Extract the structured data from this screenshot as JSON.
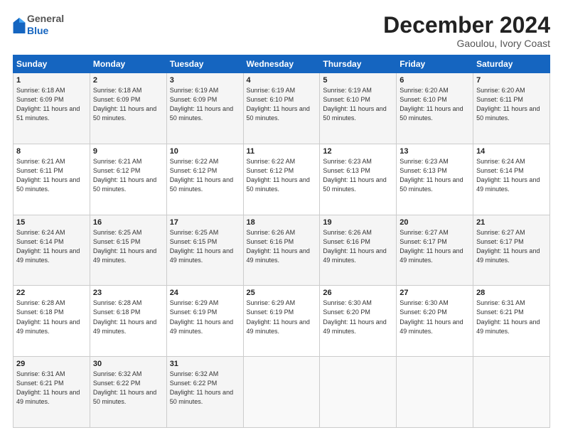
{
  "logo": {
    "general": "General",
    "blue": "Blue"
  },
  "title": "December 2024",
  "location": "Gaoulou, Ivory Coast",
  "days_header": [
    "Sunday",
    "Monday",
    "Tuesday",
    "Wednesday",
    "Thursday",
    "Friday",
    "Saturday"
  ],
  "weeks": [
    [
      {
        "day": "1",
        "sunrise": "6:18 AM",
        "sunset": "6:09 PM",
        "daylight": "11 hours and 51 minutes."
      },
      {
        "day": "2",
        "sunrise": "6:18 AM",
        "sunset": "6:09 PM",
        "daylight": "11 hours and 50 minutes."
      },
      {
        "day": "3",
        "sunrise": "6:19 AM",
        "sunset": "6:09 PM",
        "daylight": "11 hours and 50 minutes."
      },
      {
        "day": "4",
        "sunrise": "6:19 AM",
        "sunset": "6:10 PM",
        "daylight": "11 hours and 50 minutes."
      },
      {
        "day": "5",
        "sunrise": "6:19 AM",
        "sunset": "6:10 PM",
        "daylight": "11 hours and 50 minutes."
      },
      {
        "day": "6",
        "sunrise": "6:20 AM",
        "sunset": "6:10 PM",
        "daylight": "11 hours and 50 minutes."
      },
      {
        "day": "7",
        "sunrise": "6:20 AM",
        "sunset": "6:11 PM",
        "daylight": "11 hours and 50 minutes."
      }
    ],
    [
      {
        "day": "8",
        "sunrise": "6:21 AM",
        "sunset": "6:11 PM",
        "daylight": "11 hours and 50 minutes."
      },
      {
        "day": "9",
        "sunrise": "6:21 AM",
        "sunset": "6:12 PM",
        "daylight": "11 hours and 50 minutes."
      },
      {
        "day": "10",
        "sunrise": "6:22 AM",
        "sunset": "6:12 PM",
        "daylight": "11 hours and 50 minutes."
      },
      {
        "day": "11",
        "sunrise": "6:22 AM",
        "sunset": "6:12 PM",
        "daylight": "11 hours and 50 minutes."
      },
      {
        "day": "12",
        "sunrise": "6:23 AM",
        "sunset": "6:13 PM",
        "daylight": "11 hours and 50 minutes."
      },
      {
        "day": "13",
        "sunrise": "6:23 AM",
        "sunset": "6:13 PM",
        "daylight": "11 hours and 50 minutes."
      },
      {
        "day": "14",
        "sunrise": "6:24 AM",
        "sunset": "6:14 PM",
        "daylight": "11 hours and 49 minutes."
      }
    ],
    [
      {
        "day": "15",
        "sunrise": "6:24 AM",
        "sunset": "6:14 PM",
        "daylight": "11 hours and 49 minutes."
      },
      {
        "day": "16",
        "sunrise": "6:25 AM",
        "sunset": "6:15 PM",
        "daylight": "11 hours and 49 minutes."
      },
      {
        "day": "17",
        "sunrise": "6:25 AM",
        "sunset": "6:15 PM",
        "daylight": "11 hours and 49 minutes."
      },
      {
        "day": "18",
        "sunrise": "6:26 AM",
        "sunset": "6:16 PM",
        "daylight": "11 hours and 49 minutes."
      },
      {
        "day": "19",
        "sunrise": "6:26 AM",
        "sunset": "6:16 PM",
        "daylight": "11 hours and 49 minutes."
      },
      {
        "day": "20",
        "sunrise": "6:27 AM",
        "sunset": "6:17 PM",
        "daylight": "11 hours and 49 minutes."
      },
      {
        "day": "21",
        "sunrise": "6:27 AM",
        "sunset": "6:17 PM",
        "daylight": "11 hours and 49 minutes."
      }
    ],
    [
      {
        "day": "22",
        "sunrise": "6:28 AM",
        "sunset": "6:18 PM",
        "daylight": "11 hours and 49 minutes."
      },
      {
        "day": "23",
        "sunrise": "6:28 AM",
        "sunset": "6:18 PM",
        "daylight": "11 hours and 49 minutes."
      },
      {
        "day": "24",
        "sunrise": "6:29 AM",
        "sunset": "6:19 PM",
        "daylight": "11 hours and 49 minutes."
      },
      {
        "day": "25",
        "sunrise": "6:29 AM",
        "sunset": "6:19 PM",
        "daylight": "11 hours and 49 minutes."
      },
      {
        "day": "26",
        "sunrise": "6:30 AM",
        "sunset": "6:20 PM",
        "daylight": "11 hours and 49 minutes."
      },
      {
        "day": "27",
        "sunrise": "6:30 AM",
        "sunset": "6:20 PM",
        "daylight": "11 hours and 49 minutes."
      },
      {
        "day": "28",
        "sunrise": "6:31 AM",
        "sunset": "6:21 PM",
        "daylight": "11 hours and 49 minutes."
      }
    ],
    [
      {
        "day": "29",
        "sunrise": "6:31 AM",
        "sunset": "6:21 PM",
        "daylight": "11 hours and 49 minutes."
      },
      {
        "day": "30",
        "sunrise": "6:32 AM",
        "sunset": "6:22 PM",
        "daylight": "11 hours and 50 minutes."
      },
      {
        "day": "31",
        "sunrise": "6:32 AM",
        "sunset": "6:22 PM",
        "daylight": "11 hours and 50 minutes."
      },
      null,
      null,
      null,
      null
    ]
  ]
}
